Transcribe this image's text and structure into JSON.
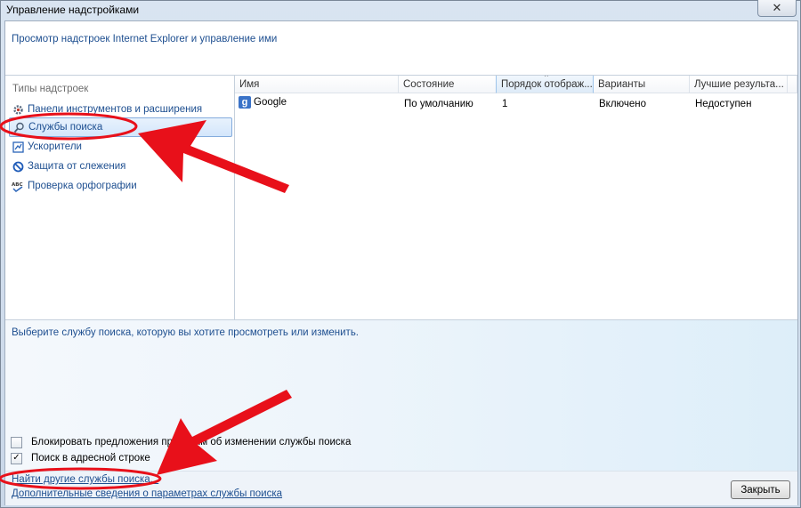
{
  "window": {
    "title": "Управление надстройками",
    "close_glyph": "✕"
  },
  "header": {
    "text": "Просмотр надстроек Internet Explorer и управление ими"
  },
  "sidebar": {
    "heading": "Типы надстроек",
    "items": [
      {
        "label": "Панели инструментов и расширения",
        "icon": "gear-icon"
      },
      {
        "label": "Службы поиска",
        "icon": "search-icon",
        "selected": true
      },
      {
        "label": "Ускорители",
        "icon": "accelerator-icon"
      },
      {
        "label": "Защита от слежения",
        "icon": "tracking-protection-icon"
      },
      {
        "label": "Проверка орфографии",
        "icon": "spelling-icon"
      }
    ]
  },
  "list": {
    "columns": [
      "Имя",
      "Состояние",
      "Порядок отображ...",
      "Варианты",
      "Лучшие результа..."
    ],
    "rows": [
      {
        "name": "Google",
        "status": "По умолчанию",
        "order": "1",
        "options": "Включено",
        "top_results": "Недоступен"
      }
    ]
  },
  "detail": {
    "text": "Выберите службу поиска, которую вы хотите просмотреть или изменить."
  },
  "options": {
    "block_suggestions_label": "Блокировать предложения программ об изменении службы поиска",
    "block_suggestions_checked": false,
    "address_bar_search_label": "Поиск в адресной строке",
    "address_bar_search_checked": true
  },
  "footer": {
    "find_more_link": "Найти другие службы поиска...",
    "more_info_link": "Дополнительные сведения о параметрах службы поиска",
    "close_button": "Закрыть"
  },
  "colors": {
    "link_blue": "#1e4f90",
    "annotation_red": "#e8101a"
  }
}
